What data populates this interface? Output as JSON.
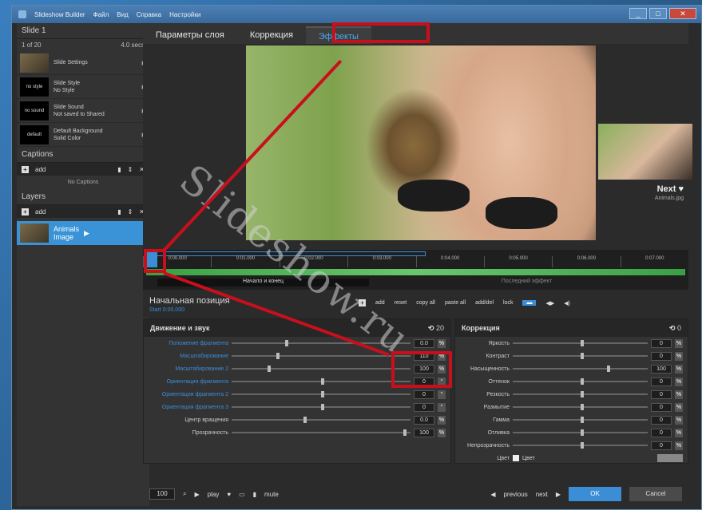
{
  "window": {
    "title": "Slideshow Builder",
    "menu": [
      "Файл",
      "Вид",
      "Справка",
      "Настройки",
      "Вид",
      "Справка"
    ]
  },
  "left": {
    "slide_title": "Slide 1",
    "slide_count": "1 of 20",
    "slide_duration": "4.0 secs",
    "items": [
      {
        "thumb": "",
        "name": "Slide Settings",
        "sub": ""
      },
      {
        "thumb": "no style",
        "name": "Slide Style",
        "sub": "No Style"
      },
      {
        "thumb": "no sound",
        "name": "Slide Sound",
        "sub": "Not saved to Shared"
      },
      {
        "thumb": "default",
        "name": "Default Background",
        "sub": "Solid Color"
      }
    ],
    "captions_title": "Captions",
    "captions_add": "add",
    "captions_none": "No Captions",
    "layers_title": "Layers",
    "layers_add": "add",
    "layer_name": "Animals",
    "layer_sub": "Image"
  },
  "tabs": [
    {
      "label": "Параметры слоя"
    },
    {
      "label": "Коррекция"
    },
    {
      "label": "Эффекты"
    }
  ],
  "preview": {
    "watermark": "Slideshow.ru",
    "next_label": "Next",
    "next_sub": "Animals.jpg"
  },
  "timeline": {
    "ticks": [
      "0:00.000",
      "0:01.000",
      "0:02.000",
      "0:03.000",
      "0:04.000",
      "0:05.000",
      "0:06.000",
      "0:07.000"
    ],
    "start_label": "Начало и конец",
    "end_label": "Последний эффект"
  },
  "position": {
    "title": "Начальная позиция",
    "subtitle": "Start 0:00.000",
    "tools": [
      "add",
      "reset",
      "copy all",
      "paste all",
      "add/del",
      "lock"
    ]
  },
  "motion_panel": {
    "title": "Движение и звук",
    "count": "20",
    "rows": [
      {
        "label": "Положение фрагмента",
        "value": "0.0"
      },
      {
        "label": "Масштабирование",
        "value": "110"
      },
      {
        "label": "Масштабирование 2",
        "value": "100"
      },
      {
        "label": "Ориентация фрагмента",
        "value": "0"
      },
      {
        "label": "Ориентация фрагмента 2",
        "value": "0"
      },
      {
        "label": "Ориентация фрагмента 3",
        "value": "0"
      },
      {
        "label": "Центр вращения",
        "value": "0.0"
      },
      {
        "label": "Прозрачность",
        "value": "100"
      }
    ]
  },
  "correction_panel": {
    "title": "Коррекция",
    "count": "0",
    "rows": [
      {
        "label": "Яркость",
        "value": "0"
      },
      {
        "label": "Контраст",
        "value": "0"
      },
      {
        "label": "Насыщенность",
        "value": "100"
      },
      {
        "label": "Оттенок",
        "value": "0"
      },
      {
        "label": "Резкость",
        "value": "0"
      },
      {
        "label": "Размытие",
        "value": "0"
      },
      {
        "label": "Гамма",
        "value": "0"
      },
      {
        "label": "Отливка",
        "value": "0"
      },
      {
        "label": "Непрозрачность",
        "value": "0"
      },
      {
        "label": "Цвет",
        "value": "Цвет"
      }
    ]
  },
  "footer": {
    "zoom": "100",
    "play": "play",
    "mute": "mute",
    "previous": "previous",
    "next": "next",
    "ok": "OK",
    "cancel": "Cancel"
  },
  "colors": {
    "accent": "#3b8ed6",
    "annotation": "#c8101c"
  }
}
